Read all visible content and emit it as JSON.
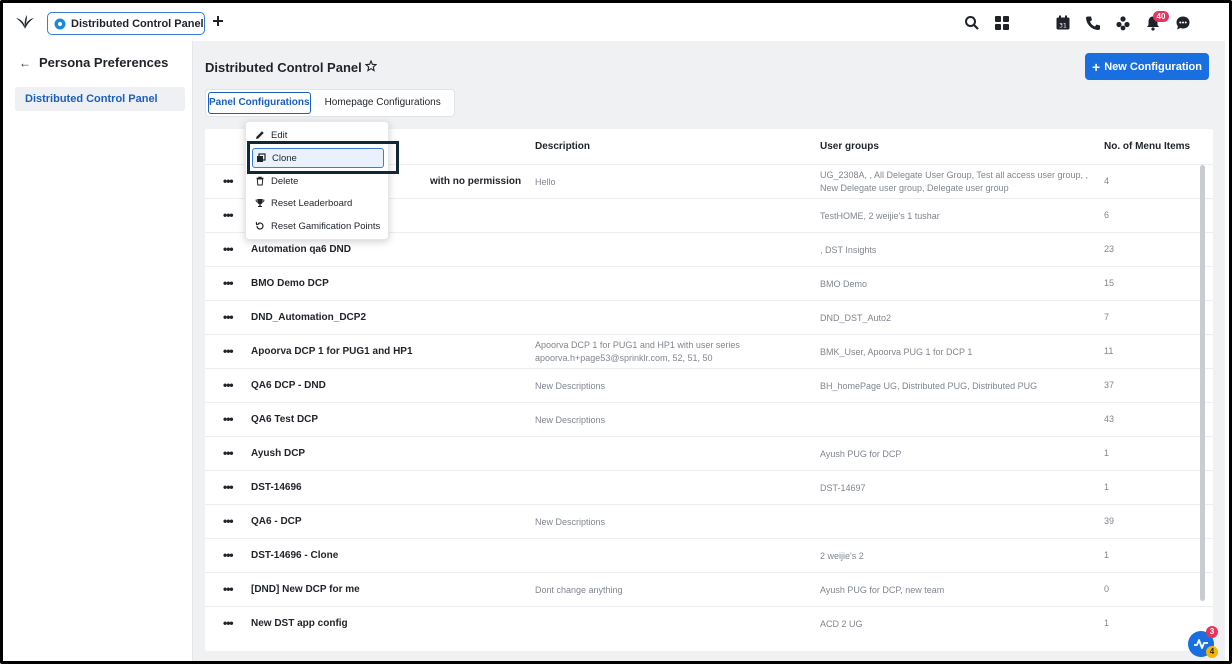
{
  "topbar": {
    "app_tab_label": "Distributed Control Panel",
    "icons": [
      "search-icon",
      "apps-grid-icon",
      "calendar-icon",
      "phone-icon",
      "community-icon",
      "bell-icon",
      "chat-icon"
    ],
    "calendar_day": "31",
    "notification_count": "40"
  },
  "sidebar": {
    "title": "Persona Preferences",
    "items": [
      {
        "label": "Distributed Control Panel"
      }
    ]
  },
  "main": {
    "title": "Distributed Control Panel",
    "new_button_label": "New Configuration",
    "tabs": [
      {
        "label": "Panel Configurations",
        "active": true
      },
      {
        "label": "Homepage Configurations",
        "active": false
      }
    ]
  },
  "table": {
    "headers": {
      "description": "Description",
      "user_groups": "User groups",
      "menu_items": "No. of Menu Items"
    },
    "rows": [
      {
        "name": "with no permission",
        "description": "Hello",
        "user_groups": "UG_2308A, , All Delegate User Group, Test all access user group, , New Delegate user group, Delegate user group",
        "menu_items": "4"
      },
      {
        "name": "",
        "description": "",
        "user_groups": "TestHOME, 2 weijie's 1 tushar",
        "menu_items": "6"
      },
      {
        "name": "Automation qa6 DND",
        "description": "",
        "user_groups": ", DST Insights",
        "menu_items": "23"
      },
      {
        "name": "BMO Demo DCP",
        "description": "",
        "user_groups": "BMO Demo",
        "menu_items": "15"
      },
      {
        "name": "DND_Automation_DCP2",
        "description": "",
        "user_groups": "DND_DST_Auto2",
        "menu_items": "7"
      },
      {
        "name": "Apoorva DCP 1 for PUG1 and HP1",
        "description": "Apoorva DCP 1 for PUG1 and HP1 with user series apoorva.h+page53@sprinklr.com, 52, 51, 50",
        "user_groups": "BMK_User, Apoorva PUG 1 for DCP 1",
        "menu_items": "11"
      },
      {
        "name": "QA6 DCP - DND",
        "description": "New Descriptions",
        "user_groups": "BH_homePage UG, Distributed PUG, Distributed PUG",
        "menu_items": "37"
      },
      {
        "name": "QA6 Test DCP",
        "description": "New Descriptions",
        "user_groups": "",
        "menu_items": "43"
      },
      {
        "name": "Ayush DCP",
        "description": "",
        "user_groups": "Ayush PUG for DCP",
        "menu_items": "1"
      },
      {
        "name": "DST-14696",
        "description": "",
        "user_groups": "DST-14697",
        "menu_items": "1"
      },
      {
        "name": "QA6 - DCP",
        "description": "New Descriptions",
        "user_groups": "",
        "menu_items": "39"
      },
      {
        "name": "DST-14696 - Clone",
        "description": "",
        "user_groups": "2 weijie's 2",
        "menu_items": "1"
      },
      {
        "name": "[DND] New DCP for me",
        "description": "Dont change anything",
        "user_groups": "Ayush PUG for DCP, new team",
        "menu_items": "0"
      },
      {
        "name": "New DST app config",
        "description": "",
        "user_groups": "ACD 2 UG",
        "menu_items": "1"
      }
    ]
  },
  "context_menu": {
    "items": [
      {
        "label": "Edit",
        "icon": "pencil-icon"
      },
      {
        "label": "Clone",
        "icon": "clone-icon",
        "highlighted": true
      },
      {
        "label": "Delete",
        "icon": "trash-icon"
      },
      {
        "label": "Reset Leaderboard",
        "icon": "trophy-icon"
      },
      {
        "label": "Reset Gamification Points",
        "icon": "reset-icon"
      }
    ]
  },
  "fab": {
    "icon": "activity-icon",
    "badge_red": "3",
    "badge_yellow": "4"
  },
  "colors": {
    "accent": "#1a6fe0",
    "badge": "#e8335a",
    "focus_ring": "#0f2a36"
  }
}
